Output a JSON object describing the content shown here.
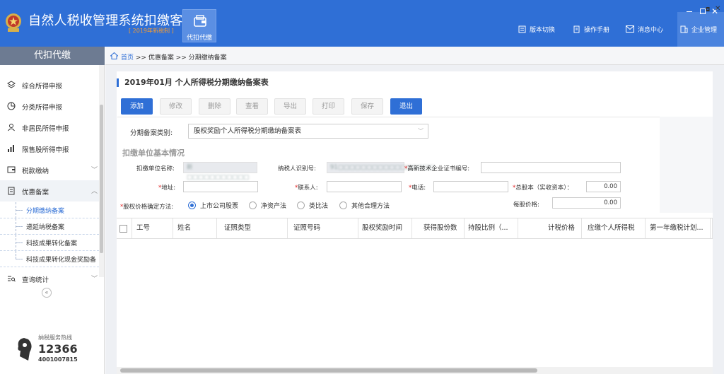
{
  "app": {
    "title": "自然人税收管理系统扣缴客户端",
    "subtitle": "[ 2019年新税制 ]",
    "module_tab": "代扣代缴"
  },
  "topnav": [
    {
      "label": "版本切换",
      "icon": "switch-icon"
    },
    {
      "label": "操作手册",
      "icon": "manual-icon"
    },
    {
      "label": "消息中心",
      "icon": "mail-icon"
    },
    {
      "label": "企业管理",
      "icon": "building-icon"
    }
  ],
  "sidebar": {
    "header": "代扣代缴",
    "items": [
      {
        "label": "综合所得申报",
        "icon": "layers-icon"
      },
      {
        "label": "分类所得申报",
        "icon": "pie-icon"
      },
      {
        "label": "非居民所得申报",
        "icon": "person-icon"
      },
      {
        "label": "限售股所得申报",
        "icon": "bars-icon"
      },
      {
        "label": "税款缴纳",
        "icon": "wallet-icon"
      },
      {
        "label": "优惠备案",
        "icon": "document-icon"
      },
      {
        "label": "查询统计",
        "icon": "query-icon"
      }
    ],
    "subitems": [
      "分期缴纳备案",
      "递延纳税备案",
      "科技成果转化备案",
      "科技成果转化现金奖励备"
    ],
    "hotline_label": "纳税服务热线",
    "hotline_number": "12366",
    "hotline_number2": "4001007815"
  },
  "breadcrumb": {
    "home": "首页",
    "path": " >> 优惠备案 >> 分期缴纳备案"
  },
  "form": {
    "title": "2019年01月  个人所得税分期缴纳备案表",
    "toolbar": [
      "添加",
      "修改",
      "删除",
      "查看",
      "导出",
      "打印",
      "保存",
      "退出"
    ],
    "category_label": "分期备案类别:",
    "category_value": "股权奖励个人所得税分期缴纳备案表",
    "section_title": "扣缴单位基本情况",
    "labels": {
      "org_name": "扣缴单位名称:",
      "tax_id": "纳税人识别号:",
      "cert": "高新技术企业证书编号:",
      "address": "地址:",
      "contact": "联系人:",
      "phone": "电话:",
      "capital": "总股本（实收资本）：",
      "method": "股权价格确定方法:",
      "share_price": "每股价格:"
    },
    "values": {
      "org_name": "新□□□□□□□□□□□",
      "tax_id": "91□□□□□□□□□□□□□□□□□",
      "capital": "0.00",
      "share_price": "0.00"
    },
    "methods": [
      "上市公司股票",
      "净资产法",
      "类比法",
      "其他合理方法"
    ]
  },
  "grid": {
    "columns": [
      "工号",
      "姓名",
      "证照类型",
      "证照号码",
      "股权奖励时间",
      "获得股份数",
      "持股比例（...",
      "计税价格",
      "应缴个人所得税",
      "第一年缴税计划...",
      "第"
    ]
  }
}
